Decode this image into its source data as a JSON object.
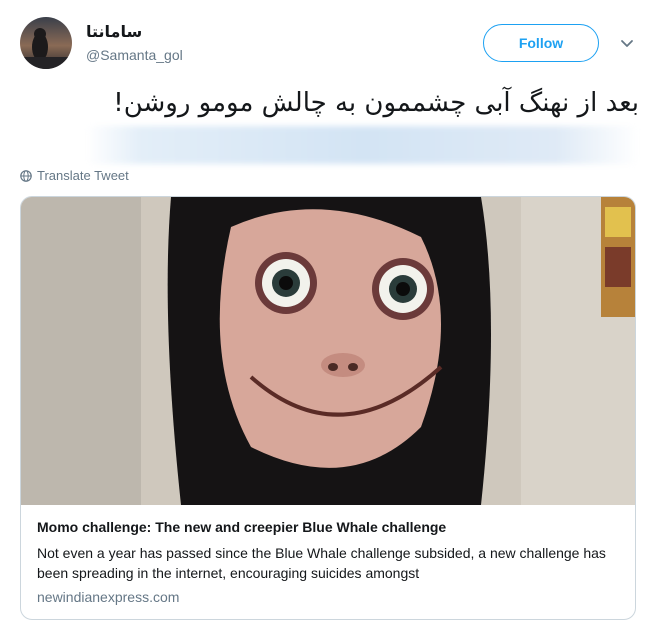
{
  "user": {
    "display_name": "سامانتا",
    "handle": "@Samanta_gol"
  },
  "actions": {
    "follow_label": "Follow"
  },
  "tweet": {
    "text": "بعد از نهنگ آبی چشممون به چالش مومو روشن!",
    "translate_label": "Translate Tweet"
  },
  "card": {
    "title": "Momo challenge: The new and creepier Blue Whale challenge",
    "description": "Not even a year has passed since the Blue Whale challenge subsided, a new challenge has been spreading in the internet, encouraging suicides amongst",
    "domain": "newindianexpress.com"
  },
  "icons": {
    "caret": "chevron-down-icon",
    "translate": "globe-icon"
  },
  "colors": {
    "accent": "#1da1f2",
    "text": "#14171a",
    "secondary": "#657786",
    "border": "#ccd6dd"
  }
}
